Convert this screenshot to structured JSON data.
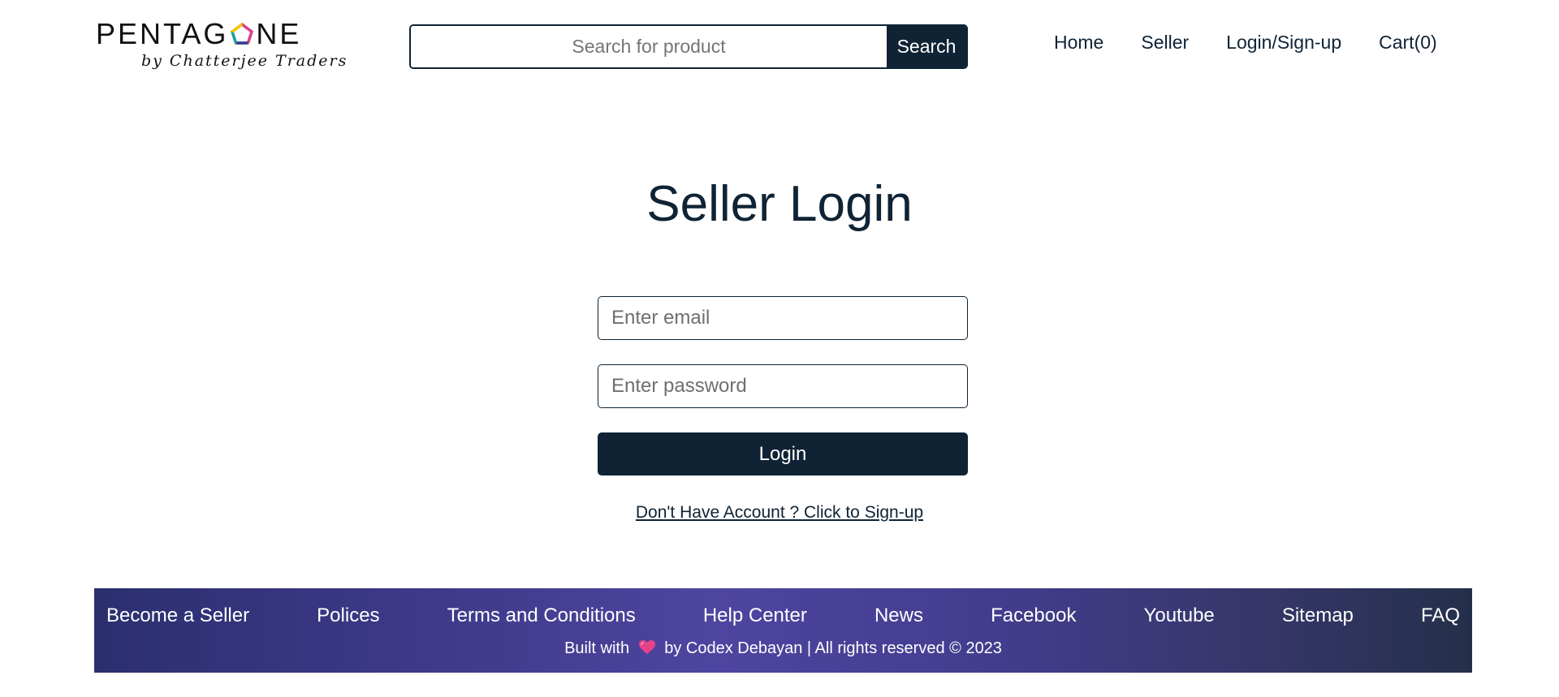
{
  "header": {
    "logo": {
      "wordmark_left": "PENTAG",
      "wordmark_right": "NE",
      "tagline": "by Chatterjee Traders",
      "icon": "pentagon-logo-icon"
    },
    "search": {
      "placeholder": "Search for product",
      "value": "",
      "button_label": "Search"
    },
    "nav": {
      "home": "Home",
      "seller": "Seller",
      "login": "Login/Sign-up",
      "cart": "Cart(0)"
    }
  },
  "main": {
    "title": "Seller Login",
    "email": {
      "placeholder": "Enter email",
      "value": ""
    },
    "password": {
      "placeholder": "Enter password",
      "value": ""
    },
    "login_label": "Login",
    "signup_link": "Don't Have Account ? Click to Sign-up"
  },
  "footer": {
    "links": {
      "become_seller": "Become a Seller",
      "polices": "Polices",
      "terms": "Terms and Conditions",
      "help": "Help Center",
      "news": "News",
      "facebook": "Facebook",
      "youtube": "Youtube",
      "sitemap": "Sitemap",
      "faq": "FAQ"
    },
    "credit_prefix": "Built with",
    "credit_icon": "heart-icon",
    "credit_suffix": "by Codex Debayan | All rights reserved © 2023"
  },
  "colors": {
    "primary": "#0f2335",
    "footer_gradient_mid": "#4e45a0",
    "heart": "#e8418a"
  }
}
